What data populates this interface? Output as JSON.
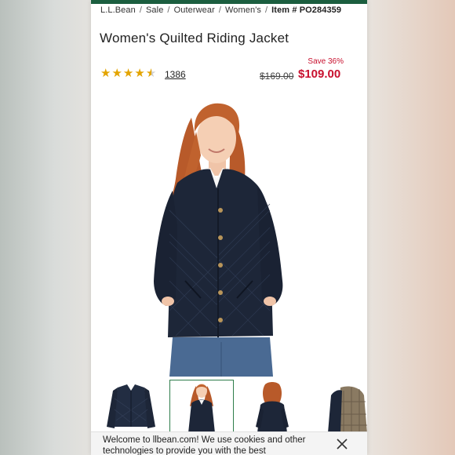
{
  "breadcrumb": {
    "items": [
      "L.L.Bean",
      "Sale",
      "Outerwear",
      "Women's"
    ],
    "separator": "/",
    "item_number": "Item # PO284359"
  },
  "product": {
    "title": "Women's Quilted Riding Jacket",
    "rating": 4.5,
    "review_count": "1386",
    "save_text": "Save 36%",
    "original_price": "$169.00",
    "sale_price": "$109.00"
  },
  "images": {
    "hero_alt": "woman-wearing-navy-quilted-jacket",
    "thumbnails": [
      "jacket-front-flat",
      "model-front",
      "model-back",
      "jacket-plaid-lining"
    ],
    "active_index": 1
  },
  "cookie_banner": {
    "text": "Welcome to llbean.com! We use cookies and other technologies to provide you with the best"
  },
  "colors": {
    "brand_green": "#1b5e3f",
    "sale_red": "#c8102e",
    "star_gold": "#e3a400"
  }
}
